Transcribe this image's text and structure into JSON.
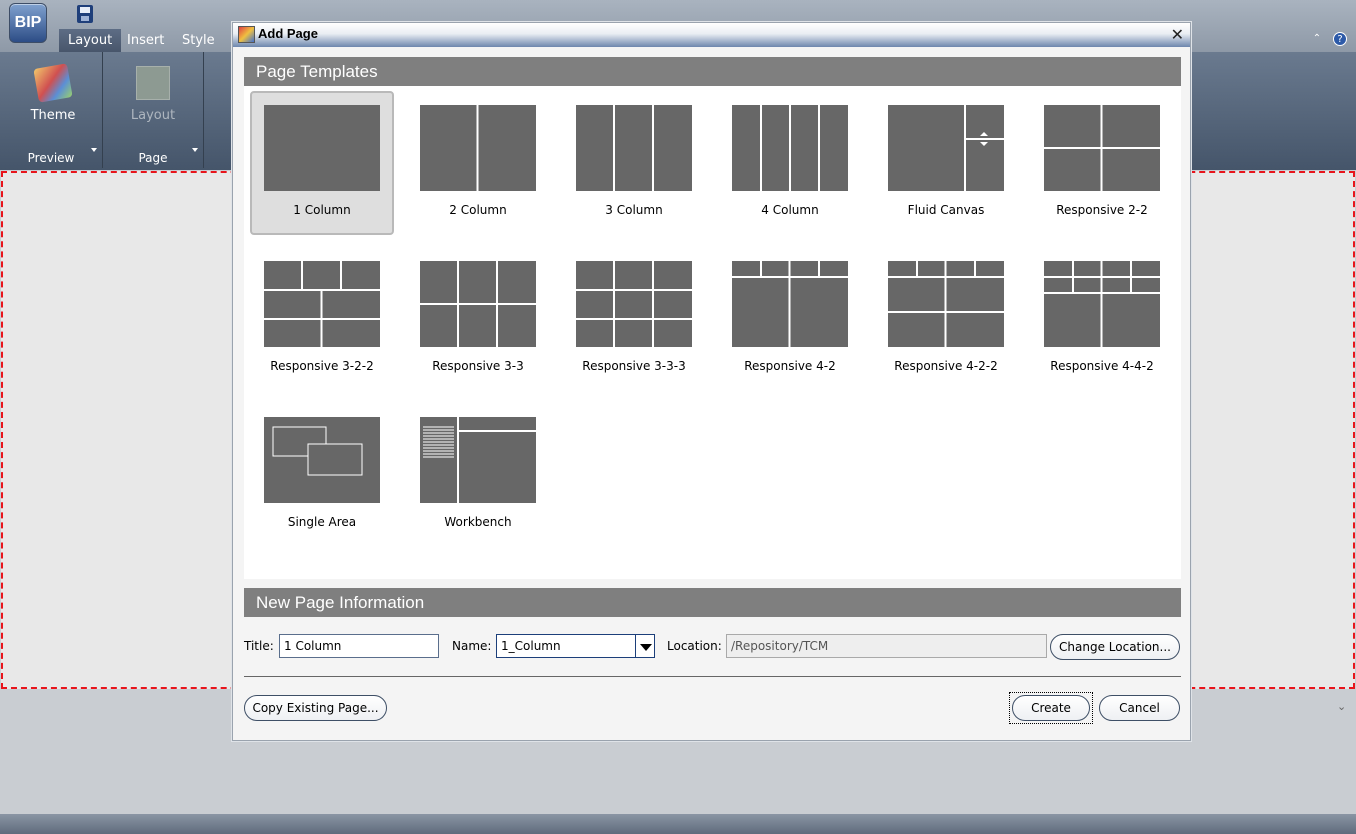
{
  "app": {
    "logo_text": "BIP",
    "tabs": [
      {
        "label": "Layout",
        "active": true
      },
      {
        "label": "Insert",
        "active": false
      },
      {
        "label": "Style",
        "active": false
      }
    ],
    "ribbon": {
      "groups": [
        {
          "label": "Preview",
          "button": "Theme"
        },
        {
          "label": "Page",
          "button": "Layout"
        }
      ]
    }
  },
  "dialog": {
    "title": "Add Page",
    "close_glyph": "✕",
    "templates_header": "Page Templates",
    "templates": [
      {
        "label": "1 Column",
        "selected": true
      },
      {
        "label": "2 Column"
      },
      {
        "label": "3 Column"
      },
      {
        "label": "4 Column"
      },
      {
        "label": "Fluid Canvas"
      },
      {
        "label": "Responsive 2-2"
      },
      {
        "label": "Responsive 3-2-2"
      },
      {
        "label": "Responsive 3-3"
      },
      {
        "label": "Responsive 3-3-3"
      },
      {
        "label": "Responsive 4-2"
      },
      {
        "label": "Responsive 4-2-2"
      },
      {
        "label": "Responsive 4-4-2"
      },
      {
        "label": "Single Area"
      },
      {
        "label": "Workbench"
      }
    ],
    "info_header": "New Page Information",
    "form": {
      "title_label": "Title:",
      "title_value": "1 Column",
      "name_label": "Name:",
      "name_value": "1_Column",
      "location_label": "Location:",
      "location_value": "/Repository/TCM",
      "change_location_button": "Change Location..."
    },
    "copy_button": "Copy Existing Page...",
    "create_button": "Create",
    "cancel_button": "Cancel"
  },
  "colors": {
    "thumb_fill": "#676767",
    "header_gray": "#7f7f7f",
    "canvas_border": "#e8141b"
  }
}
